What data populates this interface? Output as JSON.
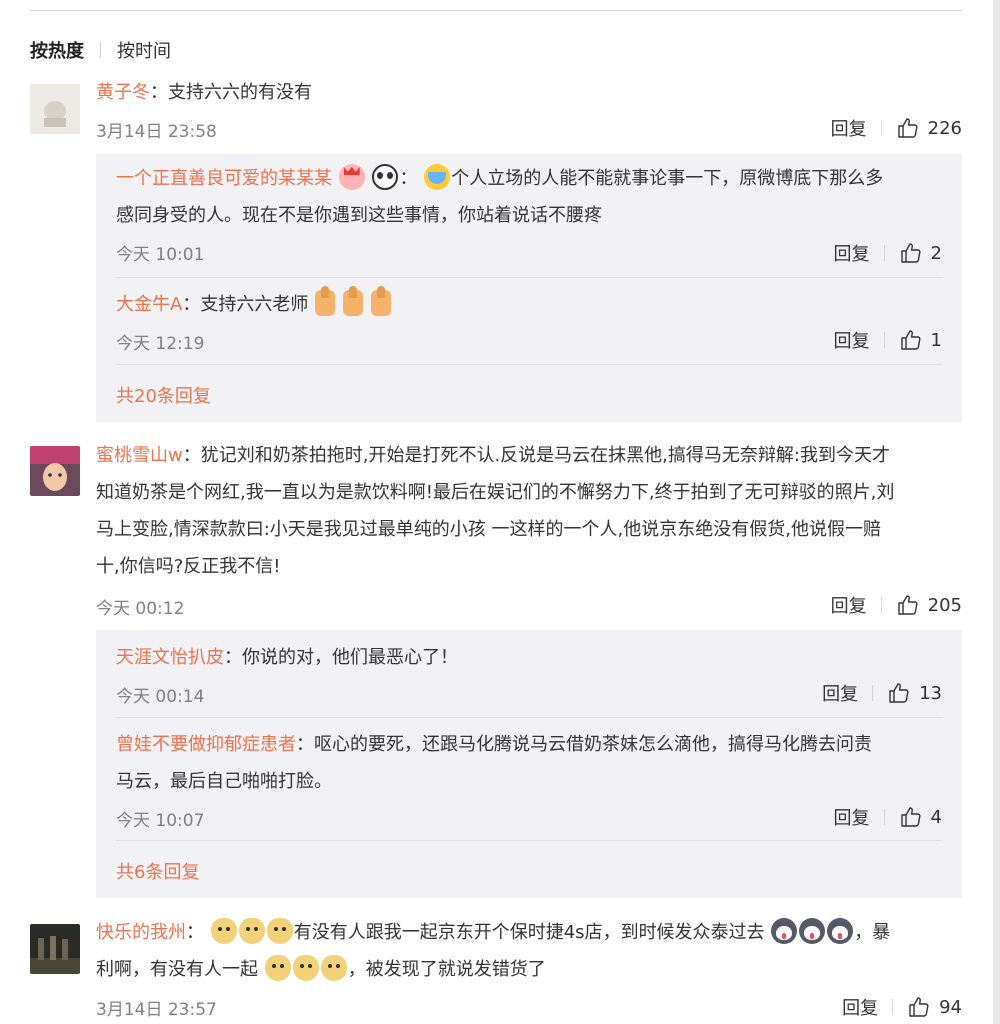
{
  "sort": {
    "hot": "按热度",
    "time": "按时间"
  },
  "colors": {
    "username": "#eb7350",
    "reply_bg": "#f2f2f5",
    "timestamp": "#808080"
  },
  "actions": {
    "reply_label": "回复"
  },
  "comments": [
    {
      "user": "黄子冬",
      "sep": "：",
      "text": "支持六六的有没有",
      "time": "3月14日 23:58",
      "likes": "226",
      "replies": [
        {
          "user": "一个正直善良可爱的某某某",
          "emoji_after_name": [
            "crown-emoji",
            "panda-emoji"
          ],
          "sep": "：",
          "emoji_before_text": [
            "crying-laugh-emoji"
          ],
          "line1": "个人立场的人能不能就事论事一下，原微博底下那么多",
          "line2": "感同身受的人。现在不是你遇到这些事情，你站着说话不腰疼",
          "time": "今天 10:01",
          "likes": "2"
        },
        {
          "user": "大金牛A",
          "sep": "：",
          "text": "支持六六老师",
          "emoji_after_text": [
            "thumbs-up-emoji",
            "thumbs-up-emoji",
            "thumbs-up-emoji"
          ],
          "time": "今天 12:19",
          "likes": "1"
        }
      ],
      "more_replies": "共20条回复"
    },
    {
      "user": "蜜桃雪山w",
      "sep": "：",
      "line1": "犹记刘和奶茶拍拖时,开始是打死不认.反说是马云在抹黑他,搞得马无奈辩解:我到今天才",
      "line2": "知道奶茶是个网红,我一直以为是款饮料啊!最后在娱记们的不懈努力下,终于拍到了无可辩驳的照片,刘",
      "line3": "马上变脸,情深款款曰:小天是我见过最单纯的小孩 一这样的一个人,他说京东绝没有假货,他说假一赔",
      "line4": "十,你信吗?反正我不信!",
      "time": "今天 00:12",
      "likes": "205",
      "replies": [
        {
          "user": "天涯文怡扒皮",
          "sep": "：",
          "text": "你说的对，他们最恶心了！",
          "time": "今天 00:14",
          "likes": "13"
        },
        {
          "user": "曾娃不要做抑郁症患者",
          "sep": "：",
          "line1": "呕心的要死，还跟马化腾说马云借奶茶妹怎么滴他，搞得马化腾去问责",
          "line2": "马云，最后自己啪啪打脸。",
          "time": "今天 10:07",
          "likes": "4"
        }
      ],
      "more_replies": "共6条回复"
    },
    {
      "user": "快乐的我州",
      "sep": "：",
      "line1_a": "有没有人跟我一起京东开个保时捷4s店，到时候发众泰过去",
      "line1_b": "，暴",
      "line2_a": "利啊，有没有人一起",
      "line2_b": "，被发现了就说发错货了",
      "emoji_groups": [
        "doge-emoji",
        "husky-emoji",
        "doge-emoji"
      ],
      "time": "3月14日 23:57",
      "likes": "94"
    }
  ]
}
